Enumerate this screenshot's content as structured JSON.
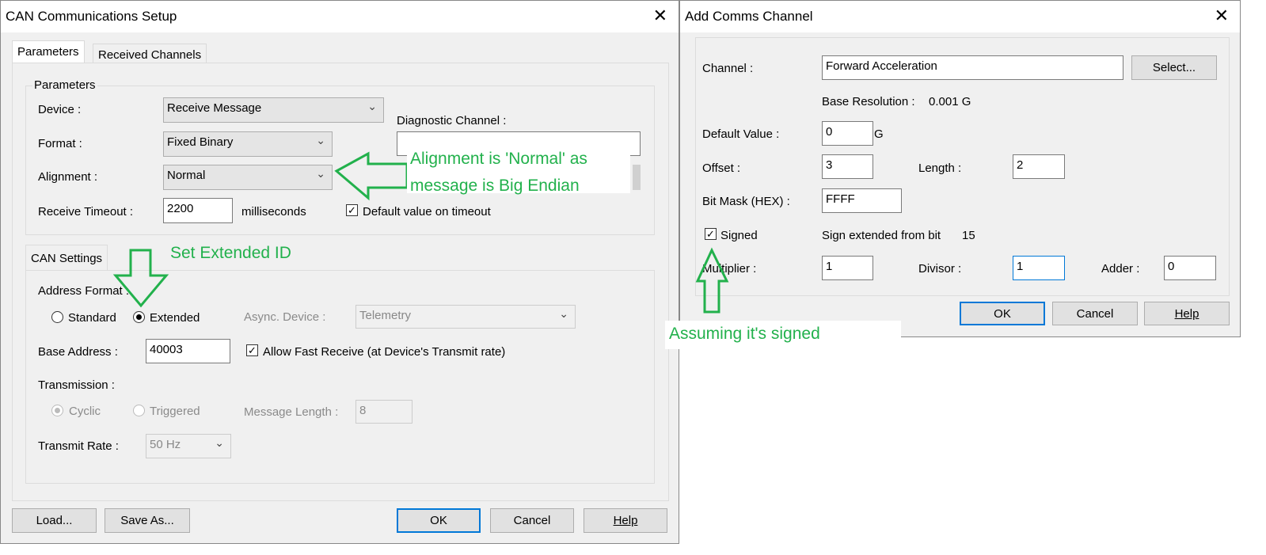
{
  "can_dialog": {
    "title": "CAN Communications Setup",
    "tabs": [
      {
        "label": "Parameters",
        "active": true
      },
      {
        "label": "Received Channels",
        "active": false
      }
    ],
    "parameters": {
      "group_label": "Parameters",
      "device_label": "Device :",
      "device_value": "Receive Message",
      "format_label": "Format :",
      "format_value": "Fixed Binary",
      "alignment_label": "Alignment :",
      "alignment_value": "Normal",
      "timeout_label": "Receive Timeout :",
      "timeout_value": "2200",
      "timeout_unit": "milliseconds",
      "default_on_timeout_label": "Default value on timeout",
      "default_on_timeout_checked": true,
      "diagnostic_label": "Diagnostic Channel :",
      "diagnostic_value": ""
    },
    "can_settings": {
      "tab_label": "CAN Settings",
      "address_format_label": "Address Format :",
      "standard_label": "Standard",
      "extended_label": "Extended",
      "selected": "Extended",
      "async_label": "Async. Device :",
      "async_value": "Telemetry",
      "base_address_label": "Base Address :",
      "base_address_value": "40003",
      "fast_receive_label": "Allow Fast Receive (at Device's Transmit rate)",
      "fast_receive_checked": true,
      "transmission_label": "Transmission :",
      "cyclic_label": "Cyclic",
      "triggered_label": "Triggered",
      "message_length_label": "Message Length :",
      "message_length_value": "8",
      "transmit_rate_label": "Transmit Rate :",
      "transmit_rate_value": "50 Hz"
    },
    "buttons": {
      "load": "Load...",
      "save_as": "Save As...",
      "ok": "OK",
      "cancel": "Cancel",
      "help": "Help"
    }
  },
  "comms_dialog": {
    "title": "Add Comms Channel",
    "channel_label": "Channel :",
    "channel_value": "Forward Acceleration",
    "select_button": "Select...",
    "base_resolution_label": "Base Resolution :",
    "base_resolution_value": "0.001 G",
    "default_value_label": "Default Value :",
    "default_value": "0",
    "default_unit": "G",
    "offset_label": "Offset :",
    "offset_value": "3",
    "length_label": "Length :",
    "length_value": "2",
    "bitmask_label": "Bit Mask (HEX) :",
    "bitmask_value": "FFFF",
    "signed_label": "Signed",
    "signed_checked": true,
    "sign_extended_label": "Sign extended from bit",
    "sign_extended_value": "15",
    "multiplier_label": "Multiplier :",
    "multiplier_value": "1",
    "divisor_label": "Divisor :",
    "divisor_value": "1",
    "adder_label": "Adder :",
    "adder_value": "0",
    "buttons": {
      "ok": "OK",
      "cancel": "Cancel",
      "help": "Help"
    }
  },
  "annotations": {
    "alignment_note_line1": "Alignment is 'Normal' as",
    "alignment_note_line2": "message is Big Endian",
    "extended_note": "Set Extended ID",
    "signed_note": "Assuming it's signed",
    "color": "#22b14c"
  }
}
